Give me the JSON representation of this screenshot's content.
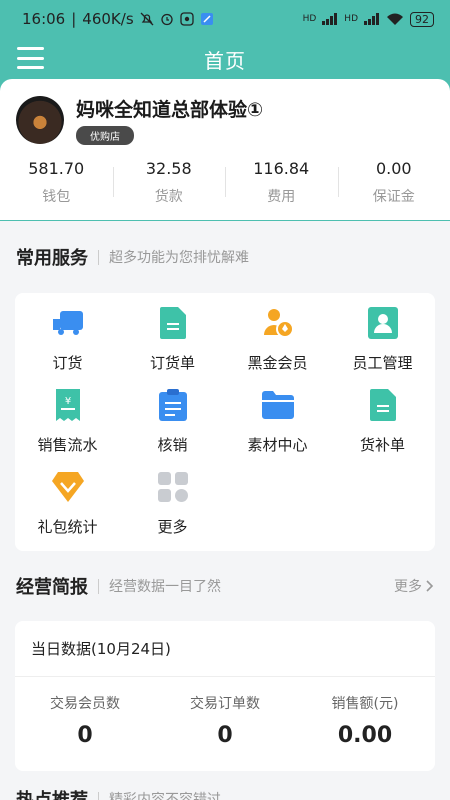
{
  "status_bar": {
    "time": "16:06",
    "speed": "460K/s",
    "battery": "92",
    "signal1": "HD",
    "signal2": "HD"
  },
  "appbar": {
    "title": "首页"
  },
  "profile": {
    "store_name": "妈咪全知道总部体验①",
    "badge": "优购店",
    "stats": [
      {
        "value": "581.70",
        "label": "钱包"
      },
      {
        "value": "32.58",
        "label": "货款"
      },
      {
        "value": "116.84",
        "label": "费用"
      },
      {
        "value": "0.00",
        "label": "保证金"
      }
    ]
  },
  "services_section": {
    "title": "常用服务",
    "subtitle": "超多功能为您排忧解难",
    "items": [
      {
        "label": "订货",
        "icon": "truck-icon",
        "color": "#3a8ef0"
      },
      {
        "label": "订货单",
        "icon": "order-doc-icon",
        "color": "#3ec2a8"
      },
      {
        "label": "黑金会员",
        "icon": "vip-member-icon",
        "color": "#f5a623"
      },
      {
        "label": "员工管理",
        "icon": "employee-card-icon",
        "color": "#3ec2a8"
      },
      {
        "label": "销售流水",
        "icon": "sales-ledger-icon",
        "color": "#3ec2a8"
      },
      {
        "label": "核销",
        "icon": "clipboard-icon",
        "color": "#3a8ef0"
      },
      {
        "label": "素材中心",
        "icon": "folder-icon",
        "color": "#3a8ef0"
      },
      {
        "label": "货补单",
        "icon": "replenish-doc-icon",
        "color": "#3ec2a8"
      },
      {
        "label": "礼包统计",
        "icon": "gift-badge-icon",
        "color": "#f5a623"
      },
      {
        "label": "更多",
        "icon": "grid-more-icon",
        "color": "#c9ccd1"
      }
    ]
  },
  "report_section": {
    "title": "经营简报",
    "subtitle": "经营数据一目了然",
    "more": "更多",
    "day_title": "当日数据(10月24日)",
    "stats": [
      {
        "label": "交易会员数",
        "value": "0"
      },
      {
        "label": "交易订单数",
        "value": "0"
      },
      {
        "label": "销售额(元)",
        "value": "0.00"
      }
    ]
  },
  "hot_section": {
    "title": "热点推荐",
    "subtitle": "精彩内容不容错过"
  },
  "colors": {
    "accent": "#4dbfb0",
    "background": "#f4f5f7"
  }
}
